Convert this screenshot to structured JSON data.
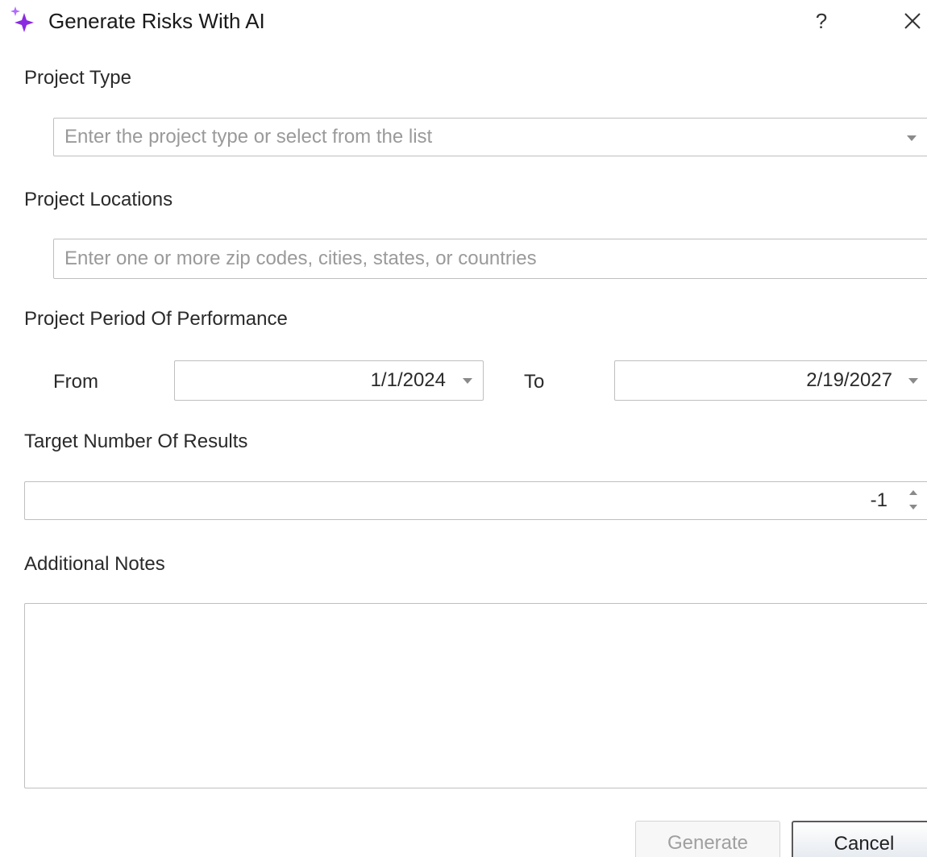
{
  "window": {
    "title": "Generate Risks With AI",
    "help_label": "?",
    "title_icon": "sparkle-icon",
    "accent_color": "#8a2be2"
  },
  "form": {
    "project_type": {
      "label": "Project Type",
      "placeholder": "Enter the project type or select from the list"
    },
    "project_locations": {
      "label": "Project Locations",
      "placeholder": "Enter one or more zip codes, cities, states, or countries"
    },
    "period": {
      "label": "Project Period Of Performance",
      "from_label": "From",
      "from_value": "1/1/2024",
      "to_label": "To",
      "to_value": "2/19/2027"
    },
    "target_results": {
      "label": "Target Number Of Results",
      "value": "-1"
    },
    "notes": {
      "label": "Additional Notes",
      "value": ""
    }
  },
  "buttons": {
    "generate_label": "Generate",
    "cancel_label": "Cancel"
  }
}
